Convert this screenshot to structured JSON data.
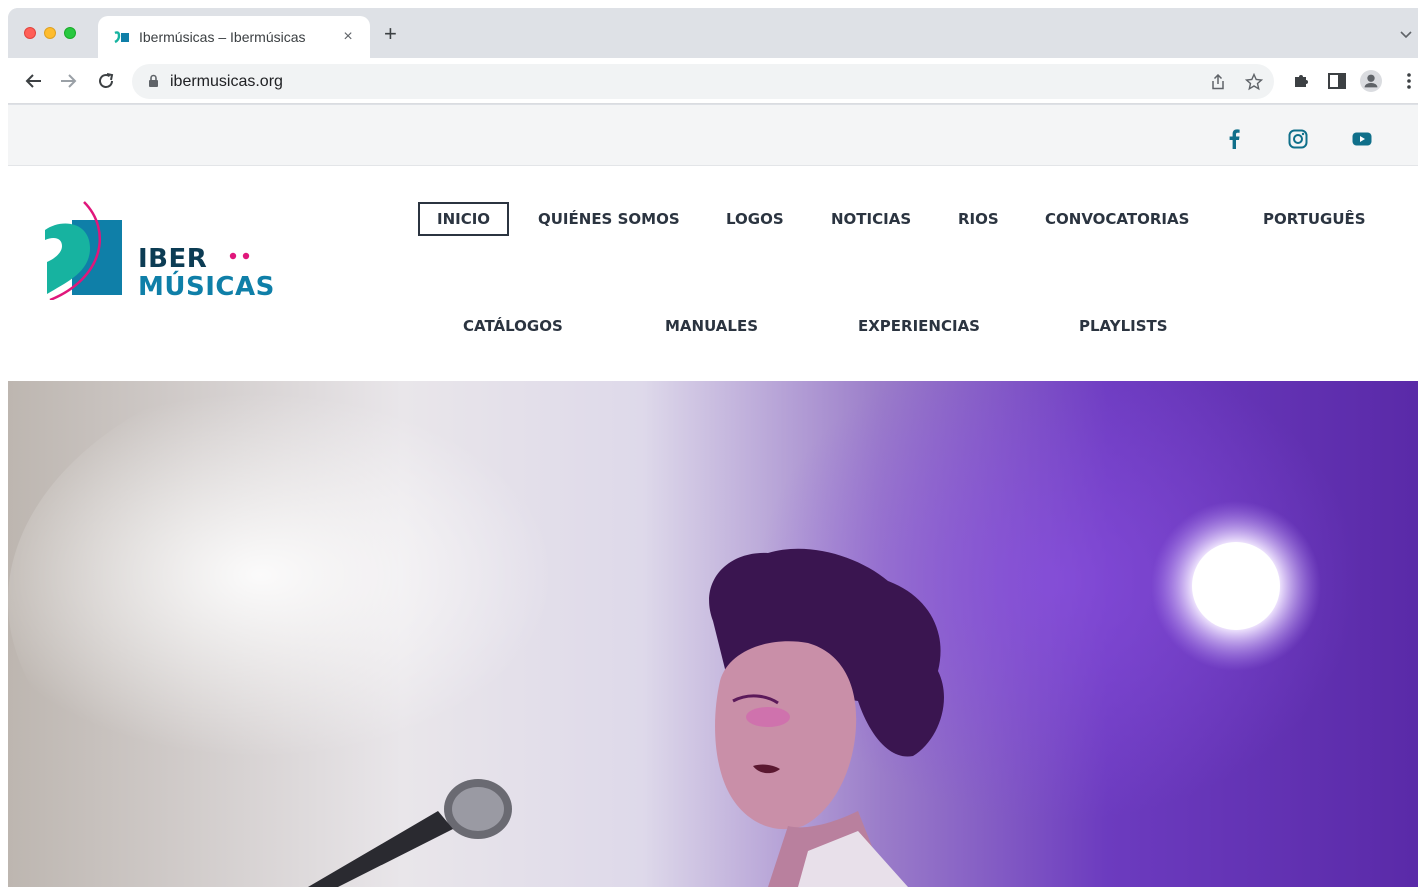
{
  "browser": {
    "tab_title": "Ibermúsicas – Ibermúsicas",
    "tab_close": "×",
    "new_tab": "+",
    "url": "ibermusicas.org"
  },
  "site": {
    "logo": {
      "line1": "IBER",
      "line2": "MÚSICAS",
      "colors": {
        "navy": "#0c3c54",
        "blue": "#0f7fa8",
        "teal": "#17b3a0",
        "magenta": "#e0177b"
      }
    },
    "social": [
      "facebook-icon",
      "instagram-icon",
      "youtube-icon"
    ],
    "menu_row1": [
      "INICIO",
      "QUIÉNES SOMOS",
      "LOGOS",
      "NOTICIAS",
      "RIOS",
      "CONVOCATORIAS",
      "PORTUGUÊS"
    ],
    "menu_row2": [
      "CATÁLOGOS",
      "MANUALES",
      "EXPERIENCIAS",
      "PLAYLISTS"
    ],
    "active_item": "INICIO",
    "accent": "#0f6f8a"
  }
}
